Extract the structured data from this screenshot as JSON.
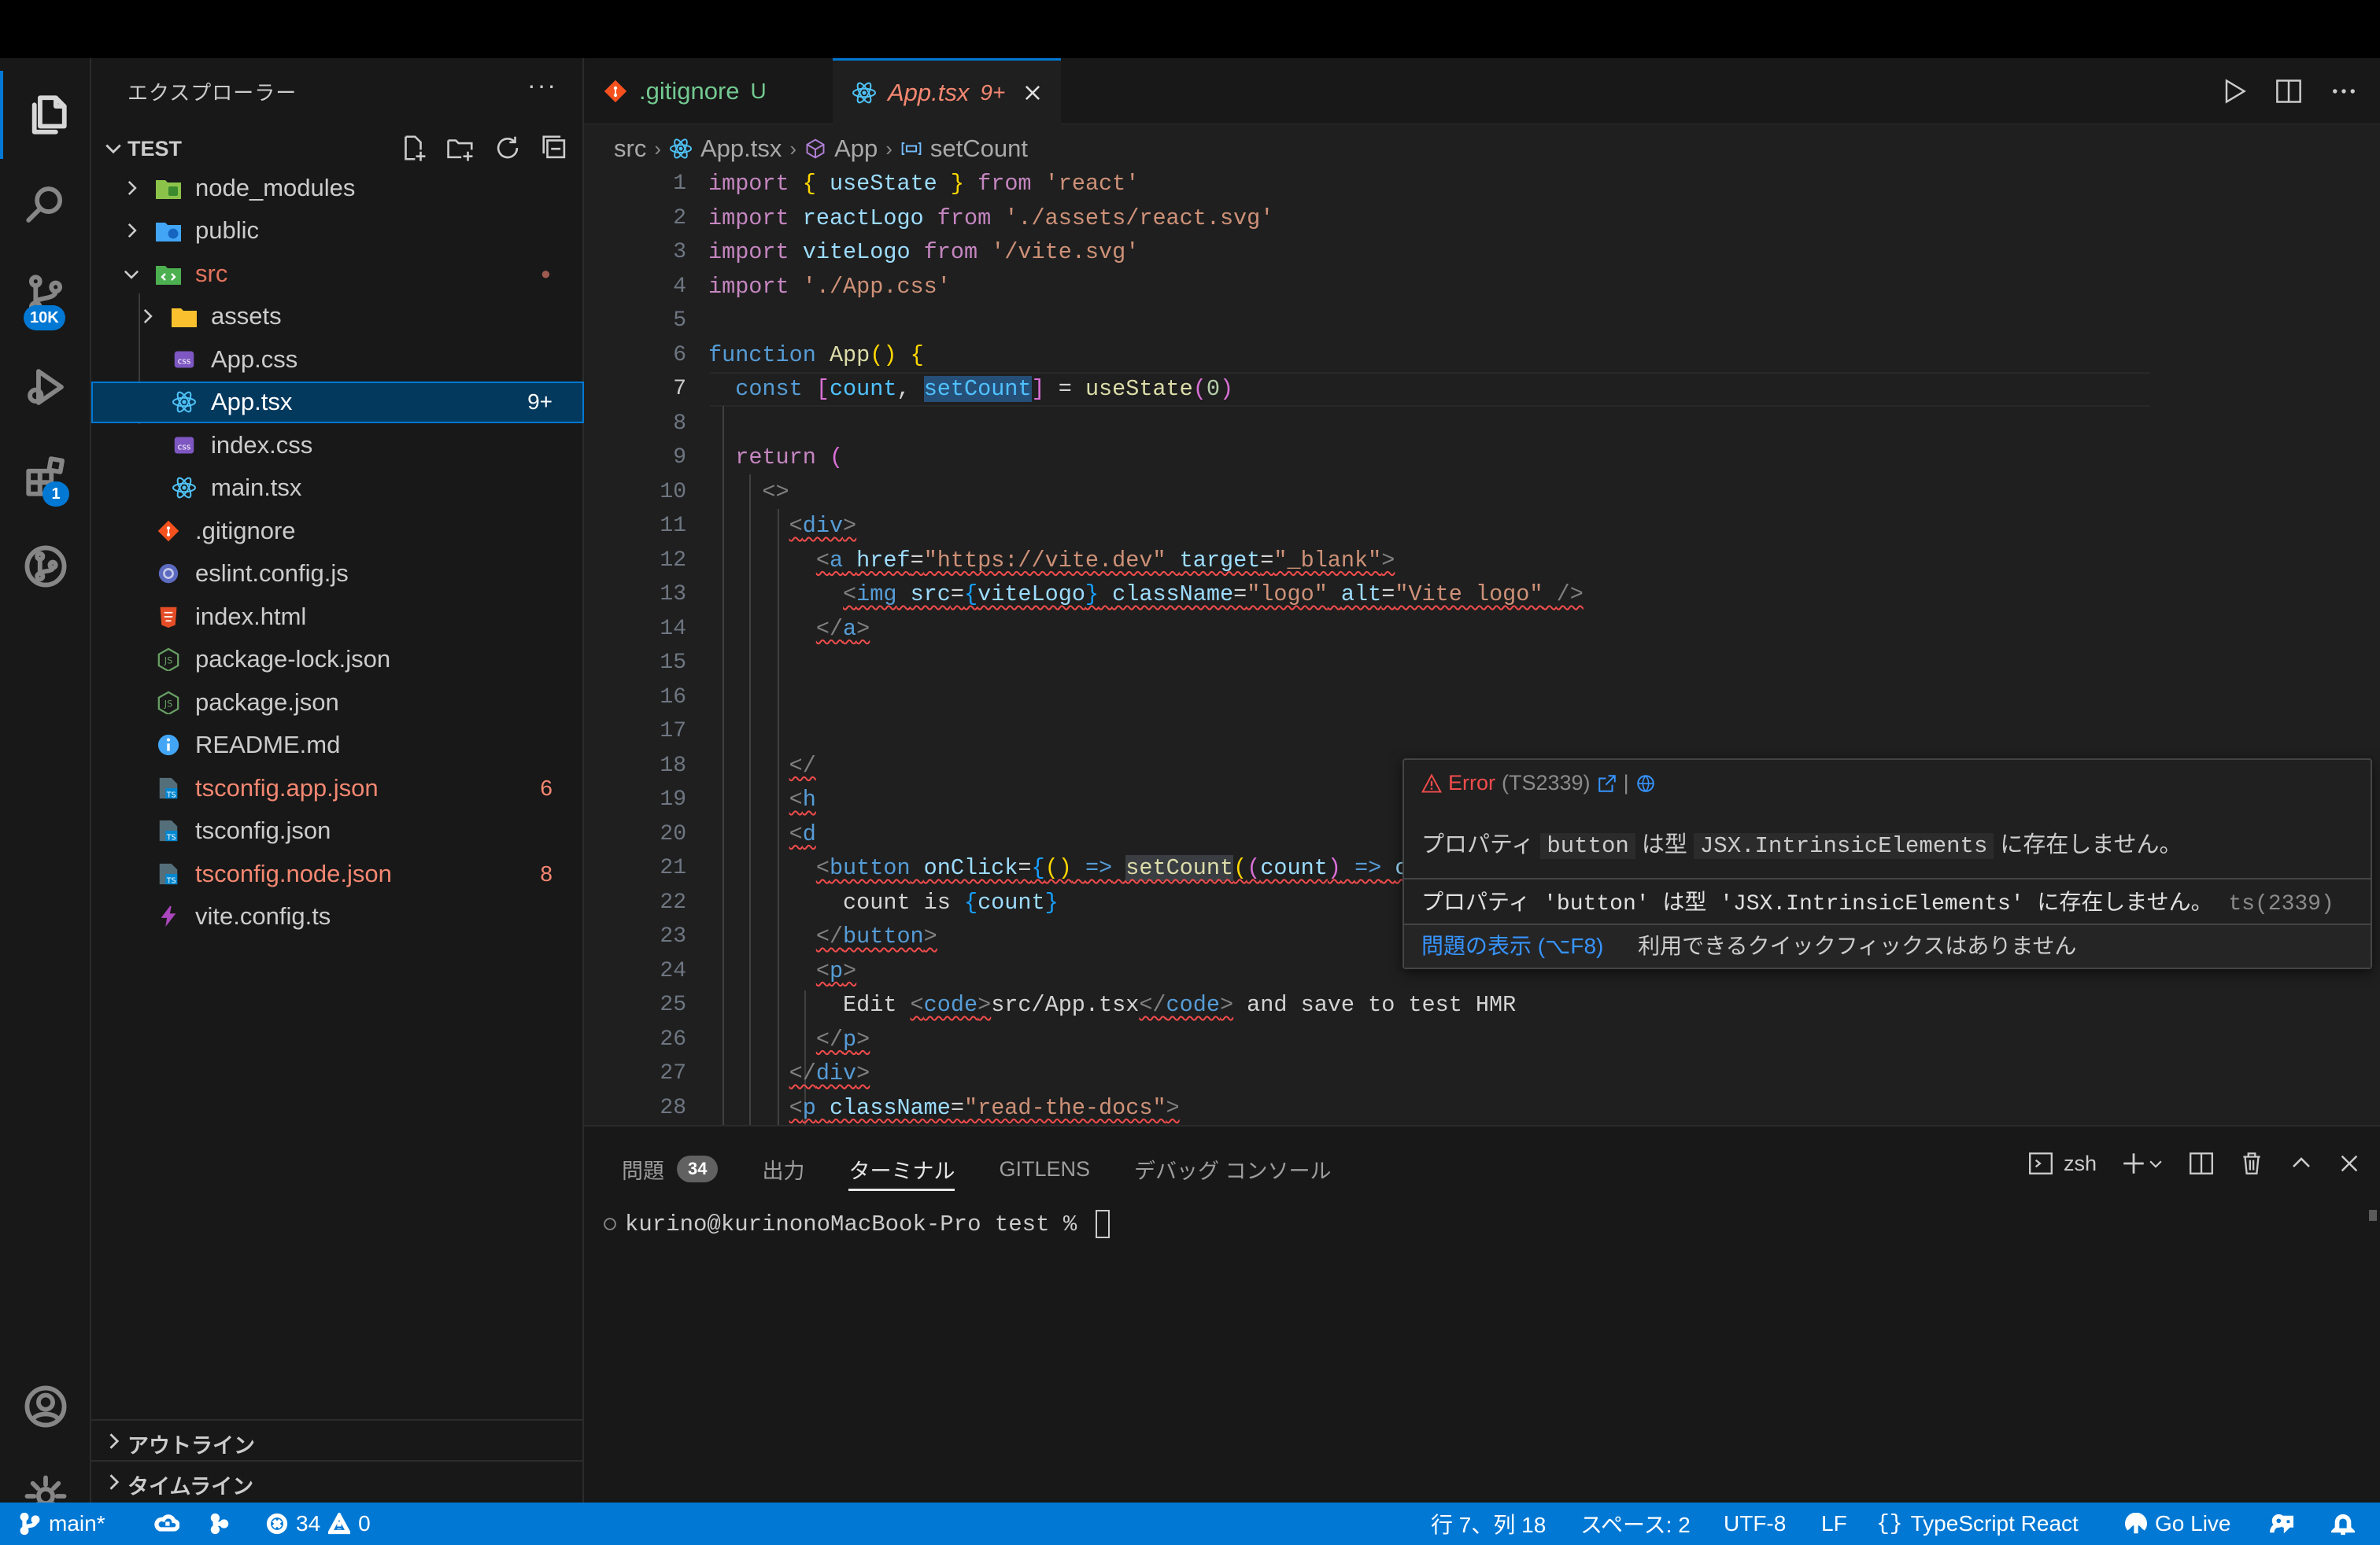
{
  "activity_bar": {
    "source_control_badge": "10K",
    "extensions_badge": "1"
  },
  "sidebar": {
    "title": "エクスプローラー",
    "more": "···",
    "section": "TEST",
    "tree": [
      {
        "label": "node_modules",
        "type": "folder-node",
        "count": "",
        "color": "#cccccc"
      },
      {
        "label": "public",
        "type": "folder-public",
        "count": "",
        "color": "#cccccc"
      },
      {
        "label": "src",
        "type": "folder-src",
        "count": "●",
        "color": "#e2735c"
      },
      {
        "label": "assets",
        "type": "folder-assets",
        "count": "",
        "color": "#cccccc"
      },
      {
        "label": "App.css",
        "type": "css",
        "count": "",
        "color": "#cccccc"
      },
      {
        "label": "App.tsx",
        "type": "react",
        "count": "9+",
        "color": "#ffffff"
      },
      {
        "label": "index.css",
        "type": "css",
        "count": "",
        "color": "#cccccc"
      },
      {
        "label": "main.tsx",
        "type": "react",
        "count": "",
        "color": "#cccccc"
      },
      {
        "label": ".gitignore",
        "type": "git",
        "count": "",
        "color": "#cccccc"
      },
      {
        "label": "eslint.config.js",
        "type": "eslint",
        "count": "",
        "color": "#cccccc"
      },
      {
        "label": "index.html",
        "type": "html",
        "count": "",
        "color": "#cccccc"
      },
      {
        "label": "package-lock.json",
        "type": "nodejs",
        "count": "",
        "color": "#cccccc"
      },
      {
        "label": "package.json",
        "type": "nodejs",
        "count": "",
        "color": "#cccccc"
      },
      {
        "label": "README.md",
        "type": "info",
        "count": "",
        "color": "#cccccc"
      },
      {
        "label": "tsconfig.app.json",
        "type": "tsconfig",
        "count": "6",
        "color": "#f48771"
      },
      {
        "label": "tsconfig.json",
        "type": "tsconfig",
        "count": "",
        "color": "#cccccc"
      },
      {
        "label": "tsconfig.node.json",
        "type": "tsconfig",
        "count": "8",
        "color": "#f48771"
      },
      {
        "label": "vite.config.ts",
        "type": "vite",
        "count": "",
        "color": "#cccccc"
      }
    ],
    "outline": "アウトライン",
    "timeline": "タイムライン"
  },
  "tabs": [
    {
      "label": ".gitignore",
      "badge": "U"
    },
    {
      "label": "App.tsx",
      "badge": "9+"
    }
  ],
  "breadcrumbs": [
    "src",
    "App.tsx",
    "App",
    "setCount"
  ],
  "editor": {
    "line_numbers": [
      "1",
      "2",
      "3",
      "4",
      "5",
      "6",
      "7",
      "8",
      "9",
      "10",
      "11",
      "12",
      "13",
      "14",
      "15",
      "16",
      "17",
      "18",
      "19",
      "20",
      "21",
      "22",
      "23",
      "24",
      "25",
      "26",
      "27",
      "28"
    ],
    "lines": [
      "import { useState } from 'react'",
      "import reactLogo from './assets/react.svg'",
      "import viteLogo from '/vite.svg'",
      "import './App.css'",
      "",
      "function App() {",
      "  const [count, setCount] = useState(0)",
      "",
      "  return (",
      "    <>",
      "      <div>",
      "        <a href=\"https://vite.dev\" target=\"_blank\">",
      "          <img src={viteLogo} className=\"logo\" alt=\"Vite logo\" />",
      "        </a>",
      "",
      "",
      "",
      "      </",
      "      <h",
      "      <d",
      "        <button onClick={() => setCount((count) => count + 1)}>",
      "          count is {count}",
      "        </button>",
      "        <p>",
      "          Edit <code>src/App.tsx</code> and save to test HMR",
      "        </p>",
      "      </div>",
      "      <p className=\"read-the-docs\">"
    ]
  },
  "hover": {
    "error_label": "Error",
    "error_code": "(TS2339)",
    "message_prefix": "プロパティ",
    "message_prop": "button",
    "message_mid": "は型",
    "message_type": "JSX.IntrinsicElements",
    "message_suffix": "に存在しません。",
    "detail": "プロパティ 'button' は型 'JSX.IntrinsicElements' に存在しません。",
    "detail_code": "ts(2339)",
    "view_problem": "問題の表示 (⌥F8)",
    "no_quickfix": "利用できるクイックフィックスはありません"
  },
  "panel": {
    "tabs": [
      "問題",
      "出力",
      "ターミナル",
      "GITLENS",
      "デバッグ コンソール"
    ],
    "problems_count": "34",
    "shell": "zsh",
    "prompt": "kurino@kurinonoMacBook-Pro test % "
  },
  "status_bar": {
    "branch": "main*",
    "errors": "34",
    "warnings": "0",
    "position": "行 7、列 18",
    "spaces": "スペース: 2",
    "encoding": "UTF-8",
    "eol": "LF",
    "language": "TypeScript React",
    "golive": "Go Live"
  },
  "colors": {
    "accent": "#0078d4",
    "error": "#f14c4c",
    "modified": "#f48771"
  }
}
